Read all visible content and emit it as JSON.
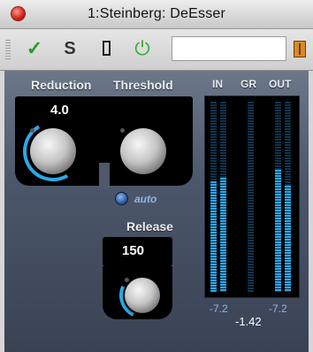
{
  "window": {
    "title": "1:Steinberg: DeEsser"
  },
  "toolbar": {
    "bypass_icon": "checkmark-icon",
    "solo_label": "S",
    "freeze_icon": "rectangle-icon",
    "power_icon": "power-icon",
    "preset_value": "",
    "preset_icon": "book-icon"
  },
  "plugin": {
    "reduction": {
      "label": "Reduction",
      "value": "4.0"
    },
    "threshold": {
      "label": "Threshold"
    },
    "auto": {
      "label": "auto"
    },
    "release": {
      "label": "Release",
      "value": "150"
    },
    "meters": {
      "in_label": "IN",
      "gr_label": "GR",
      "out_label": "OUT",
      "in_value": "-7.2",
      "gr_value": "-1.42",
      "out_value": "-7.2",
      "in_level": [
        0.58,
        0.6
      ],
      "gr_level": 0.0,
      "out_level": [
        0.64,
        0.56
      ]
    }
  },
  "colors": {
    "accent": "#2fa8e8",
    "panel": "#4c566a",
    "power": "#2fae2f"
  }
}
